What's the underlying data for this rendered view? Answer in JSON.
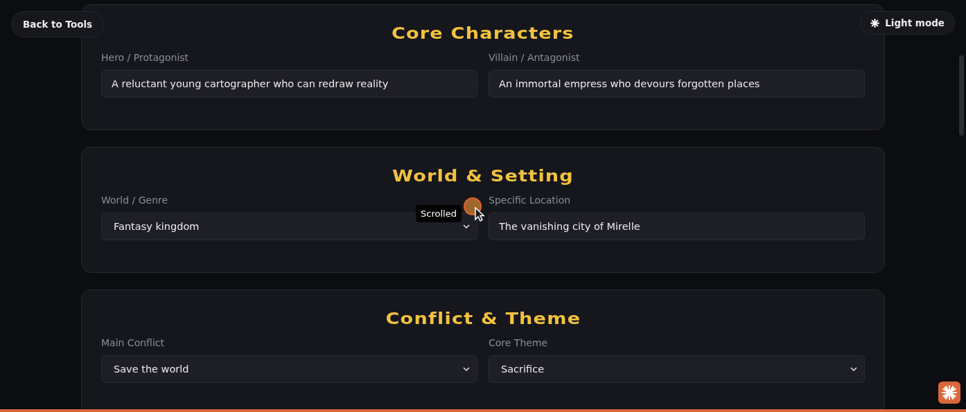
{
  "back_button": {
    "label": "Back to Tools"
  },
  "theme_button": {
    "label": "Light mode"
  },
  "sections": [
    {
      "title": "Core Characters",
      "fields": [
        {
          "label": "Hero / Protagonist",
          "kind": "text",
          "value": "A reluctant young cartographer who can redraw reality"
        },
        {
          "label": "Villain / Antagonist",
          "kind": "text",
          "value": "An immortal empress who devours forgotten places"
        }
      ]
    },
    {
      "title": "World & Setting",
      "fields": [
        {
          "label": "World / Genre",
          "kind": "select",
          "value": "Fantasy kingdom"
        },
        {
          "label": "Specific Location",
          "kind": "text",
          "value": "The vanishing city of Mirelle"
        }
      ]
    },
    {
      "title": "Conflict & Theme",
      "fields": [
        {
          "label": "Main Conflict",
          "kind": "select",
          "value": "Save the world"
        },
        {
          "label": "Core Theme",
          "kind": "select",
          "value": "Sacrifice"
        }
      ]
    }
  ],
  "cursor_tooltip": {
    "label": "Scrolled"
  }
}
